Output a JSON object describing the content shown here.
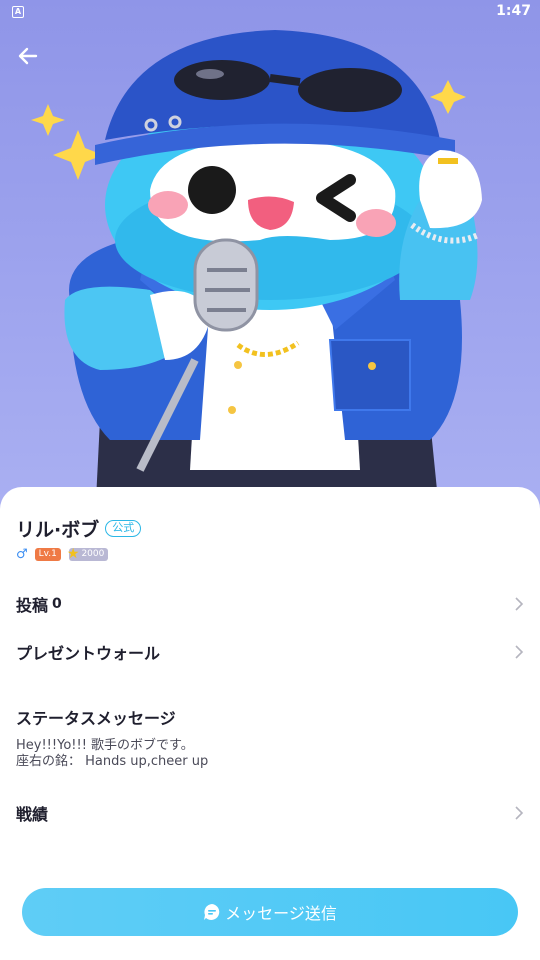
{
  "status_bar": {
    "time": "1:47",
    "app_icon": "A"
  },
  "header": {
    "back_icon": "arrow-left-icon"
  },
  "profile": {
    "name": "リル·ボブ",
    "official_badge": "公式",
    "gender_icon": "♂",
    "level": "Lv.1",
    "star_count": "2000"
  },
  "menu": {
    "posts_label": "投稿",
    "posts_count": "0",
    "gift_wall_label": "プレゼントウォール",
    "status_title": "ステータスメッセージ",
    "status_line1": "Hey!!!Yo!!! 歌手のボブです。",
    "status_line2": "座右の銘： Hands up,cheer up",
    "record_label": "戦績"
  },
  "footer": {
    "send_label": "メッセージ送信"
  },
  "colors": {
    "accent": "#48c7f5",
    "hero_bg": "#9ea4ee",
    "level_badge": "#ef7a45",
    "official": "#2cb7e6"
  }
}
